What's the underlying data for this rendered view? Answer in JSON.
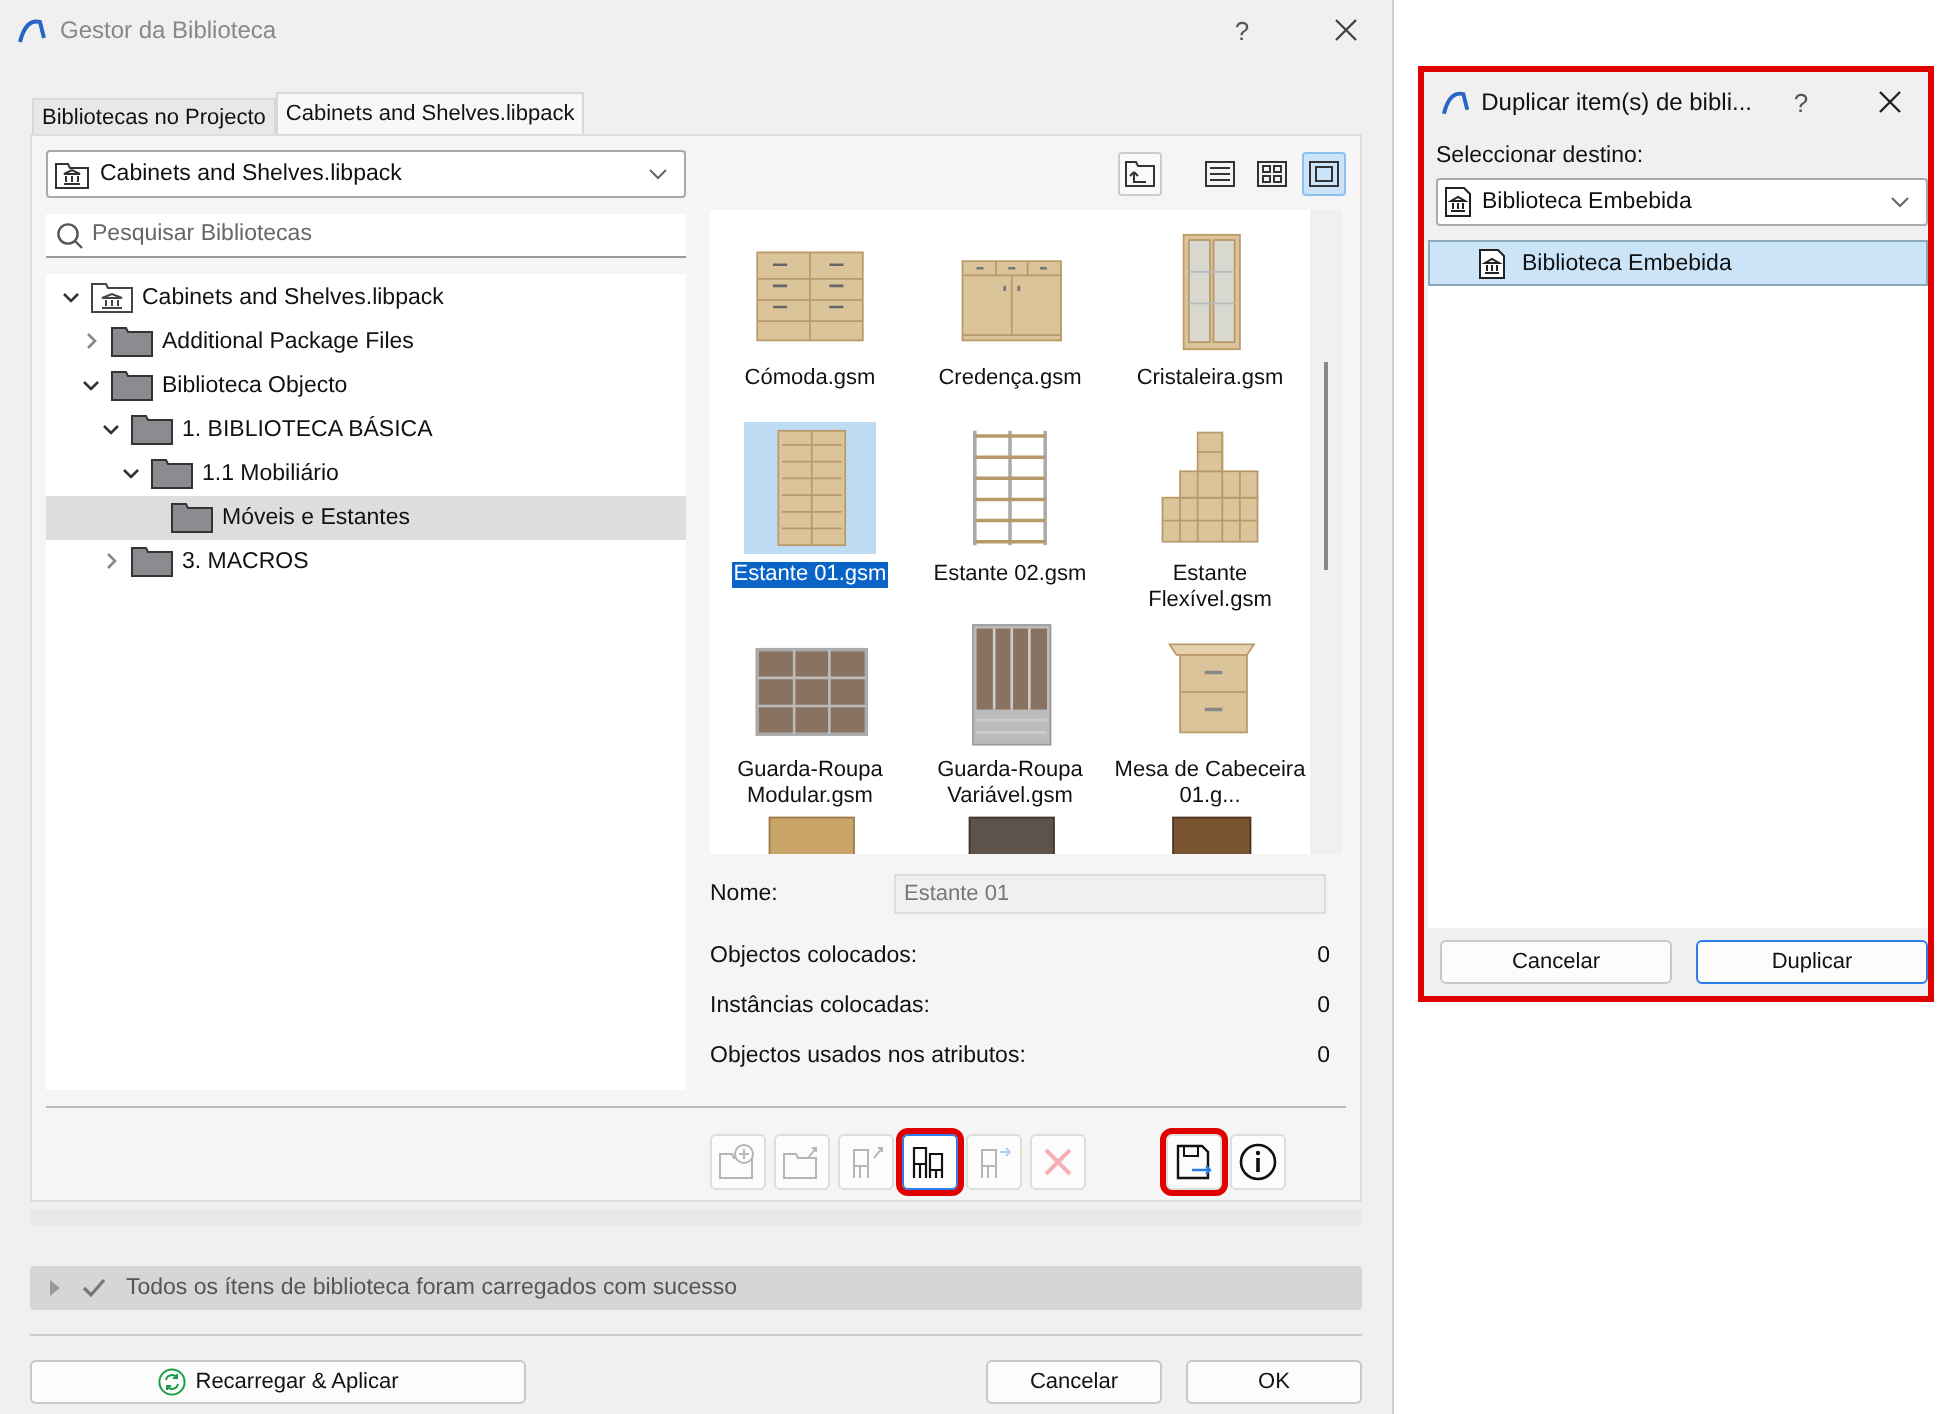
{
  "main_window": {
    "title": "Gestor da Biblioteca",
    "help": "?"
  },
  "tabs": [
    {
      "label": "Bibliotecas no Projecto",
      "selected": false
    },
    {
      "label": "Cabinets and Shelves.libpack",
      "selected": true
    }
  ],
  "library_dropdown": {
    "value": "Cabinets and Shelves.libpack"
  },
  "search": {
    "placeholder": "Pesquisar Bibliotecas"
  },
  "tree": [
    {
      "label": "Cabinets and Shelves.libpack",
      "kind": "library",
      "expandable": true,
      "expanded": true,
      "selected": false,
      "children": [
        {
          "label": "Additional Package Files",
          "kind": "folder",
          "expandable": true,
          "expanded": false,
          "selected": false
        },
        {
          "label": "Biblioteca Objecto",
          "kind": "folder",
          "expandable": true,
          "expanded": true,
          "selected": false,
          "children": [
            {
              "label": "1. BIBLIOTECA BÁSICA",
              "kind": "folder",
              "expandable": true,
              "expanded": true,
              "selected": false,
              "children": [
                {
                  "label": "1.1 Mobiliário",
                  "kind": "folder",
                  "expandable": true,
                  "expanded": true,
                  "selected": false,
                  "children": [
                    {
                      "label": "Móveis e Estantes",
                      "kind": "folder",
                      "expandable": false,
                      "expanded": false,
                      "selected": true
                    }
                  ]
                }
              ]
            },
            {
              "label": "3. MACROS",
              "kind": "folder",
              "expandable": true,
              "expanded": false,
              "selected": false
            }
          ]
        }
      ]
    }
  ],
  "view_buttons": [
    {
      "kind": "up-folder",
      "selected": false
    },
    {
      "kind": "list",
      "selected": false
    },
    {
      "kind": "grid",
      "selected": false
    },
    {
      "kind": "large",
      "selected": true
    }
  ],
  "items": [
    {
      "label": "Cómoda.gsm",
      "kind": "dresser",
      "selected": false
    },
    {
      "label": "Credença.gsm",
      "kind": "sideboard",
      "selected": false
    },
    {
      "label": "Cristaleira.gsm",
      "kind": "glass-cabinet",
      "selected": false
    },
    {
      "label": "Estante 01.gsm",
      "kind": "bookcase",
      "selected": true
    },
    {
      "label": "Estante 02.gsm",
      "kind": "metal-shelf",
      "selected": false
    },
    {
      "label": "Estante Flexível.gsm",
      "kind": "stepped-shelf",
      "selected": false
    },
    {
      "label": "Guarda-Roupa Modular.gsm",
      "kind": "sliding-wardrobe",
      "selected": false
    },
    {
      "label": "Guarda-Roupa Variável.gsm",
      "kind": "wardrobe",
      "selected": false
    },
    {
      "label": "Mesa de Cabeceira 01.g...",
      "kind": "nightstand",
      "selected": false
    },
    {
      "kind": "side-table",
      "selected": false
    },
    {
      "kind": "dark-cabinet",
      "selected": false
    },
    {
      "kind": "chest",
      "selected": false
    }
  ],
  "details": {
    "name_label": "Nome:",
    "name_value": "Estante 01",
    "stats": [
      {
        "label": "Objectos colocados:",
        "value": "0"
      },
      {
        "label": "Instâncias colocadas:",
        "value": "0"
      },
      {
        "label": "Objectos usados nos atributos:",
        "value": "0"
      }
    ]
  },
  "actions": [
    {
      "kind": "folder-add",
      "disabled": true,
      "selected": false,
      "highlighted": false
    },
    {
      "kind": "folder-export",
      "disabled": true,
      "selected": false,
      "highlighted": false
    },
    {
      "kind": "chair-up",
      "disabled": true,
      "selected": false,
      "highlighted": false
    },
    {
      "kind": "chairs",
      "disabled": false,
      "selected": true,
      "highlighted": true
    },
    {
      "kind": "chair-right",
      "disabled": true,
      "selected": false,
      "highlighted": false
    },
    {
      "kind": "delete",
      "disabled": true,
      "selected": false,
      "highlighted": false
    }
  ],
  "side_actions": [
    {
      "kind": "save-as",
      "disabled": false,
      "selected": false,
      "highlighted": true
    },
    {
      "kind": "info",
      "disabled": false,
      "selected": false,
      "highlighted": false
    }
  ],
  "status": {
    "message": "Todos os ítens de biblioteca foram carregados com sucesso",
    "expanded": false
  },
  "footer": {
    "reload": "Recarregar & Aplicar",
    "cancel": "Cancelar",
    "ok": "OK"
  },
  "duplicate_dialog": {
    "title": "Duplicar item(s) de bibli...",
    "help": "?",
    "highlighted": true,
    "label": "Seleccionar destino:",
    "dropdown_value": "Biblioteca Embebida",
    "destinations": [
      {
        "label": "Biblioteca Embebida",
        "selected": true
      }
    ],
    "cancel": "Cancelar",
    "confirm": "Duplicar"
  }
}
